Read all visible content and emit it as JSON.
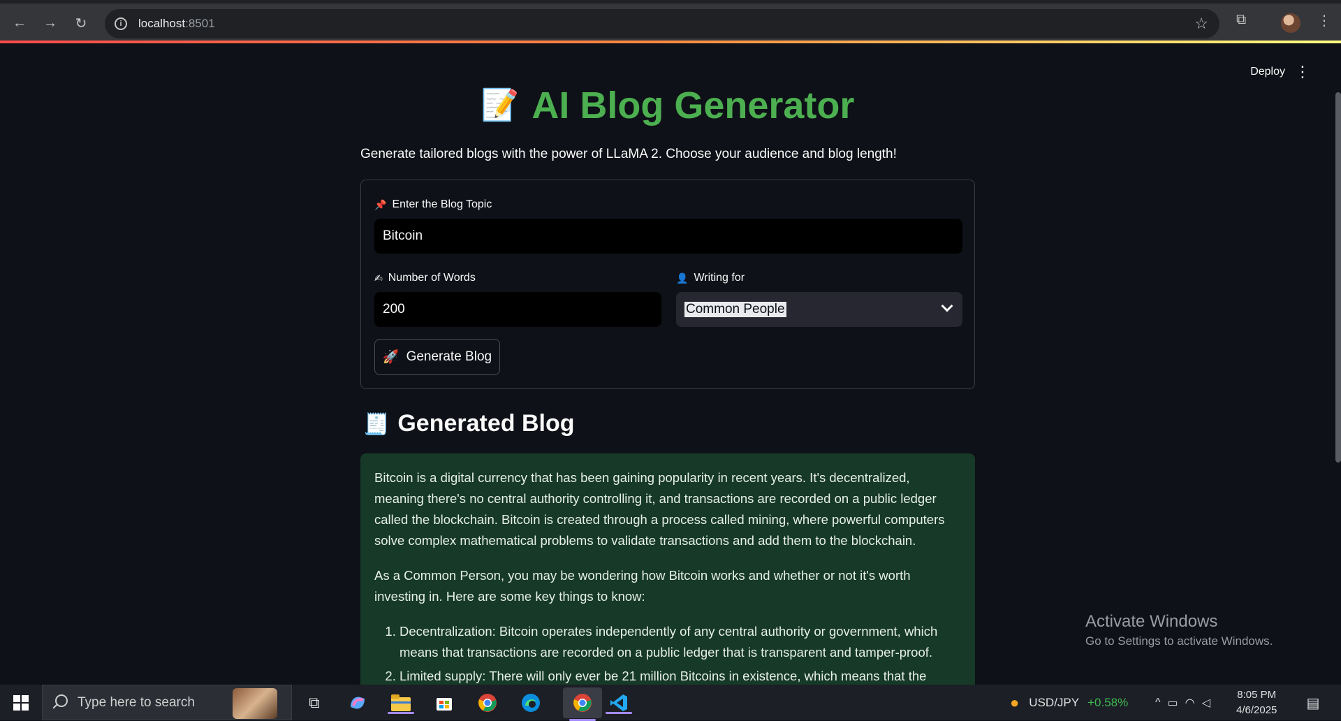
{
  "browser": {
    "url_host": "localhost",
    "url_port": ":8501"
  },
  "app": {
    "deploy_label": "Deploy",
    "title": "AI Blog Generator",
    "title_emoji": "📝",
    "subtitle": "Generate tailored blogs with the power of LLaMA 2. Choose your audience and blog length!",
    "form": {
      "topic_label": "Enter the Blog Topic",
      "topic_icon": "📌",
      "topic_value": "Bitcoin",
      "words_label": "Number of Words",
      "words_icon": "✍",
      "words_value": "200",
      "audience_label": "Writing for",
      "audience_icon": "👤",
      "audience_value": "Common People",
      "button_icon": "🚀",
      "button_label": "Generate Blog"
    },
    "generated": {
      "heading_emoji": "🧾",
      "heading": "Generated Blog",
      "paragraphs": [
        "Bitcoin is a digital currency that has been gaining popularity in recent years. It's decentralized, meaning there's no central authority controlling it, and transactions are recorded on a public ledger called the blockchain. Bitcoin is created through a process called mining, where powerful computers solve complex mathematical problems to validate transactions and add them to the blockchain.",
        "As a Common Person, you may be wondering how Bitcoin works and whether or not it's worth investing in. Here are some key things to know:"
      ],
      "list": [
        "Decentralization: Bitcoin operates independently of any central authority or government, which means that transactions are recorded on a public ledger that is transparent and tamper-proof.",
        "Limited supply: There will only ever be 21 million Bitcoins in existence, which means that the"
      ]
    }
  },
  "watermark": {
    "line1": "Activate Windows",
    "line2": "Go to Settings to activate Windows."
  },
  "taskbar": {
    "search_placeholder": "Type here to search",
    "ticker_name": "USD/JPY",
    "ticker_change": "+0.58%",
    "time": "8:05 PM",
    "date": "4/6/2025"
  }
}
